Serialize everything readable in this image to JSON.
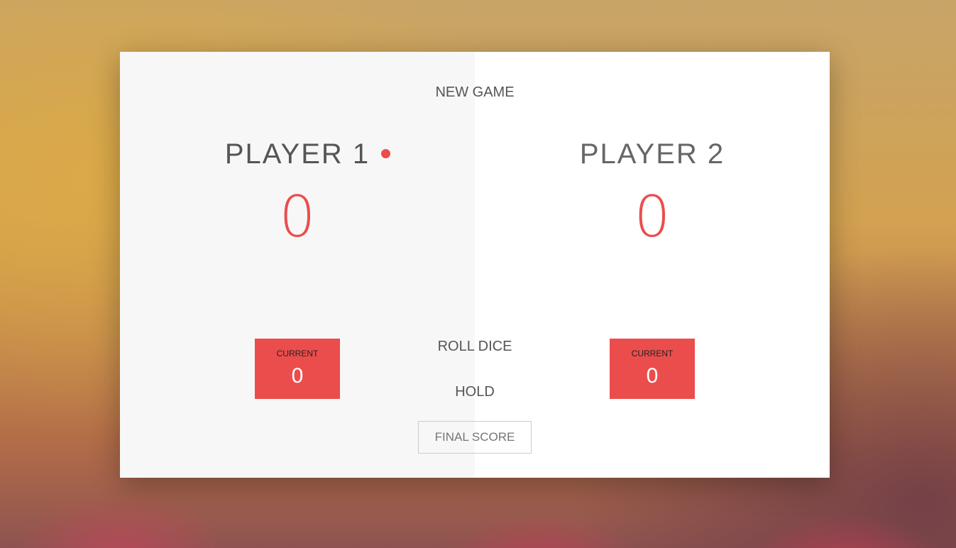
{
  "game": {
    "new_game_label": "NEW GAME",
    "roll_dice_label": "ROLL DICE",
    "hold_label": "HOLD",
    "final_score_placeholder": "FINAL SCORE",
    "active_player": 1
  },
  "players": [
    {
      "name": "PLAYER 1",
      "score": "0",
      "current_label": "CURRENT",
      "current_score": "0"
    },
    {
      "name": "PLAYER 2",
      "score": "0",
      "current_label": "CURRENT",
      "current_score": "0"
    }
  ],
  "colors": {
    "accent": "#eb4d4d",
    "panel_active": "#f7f7f7",
    "panel_inactive": "#ffffff"
  }
}
